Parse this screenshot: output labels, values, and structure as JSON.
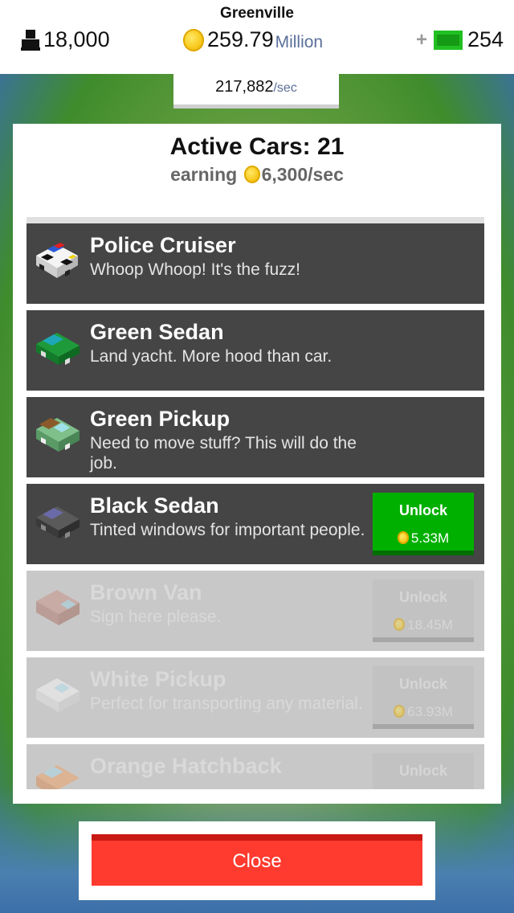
{
  "hud": {
    "city": "Greenville",
    "population": "18,000",
    "money_value": "259.79",
    "money_unit": "Million",
    "cash_plus": "+",
    "cash": "254",
    "rate_value": "217,882",
    "rate_unit": "/sec"
  },
  "panel": {
    "title": "Active Cars: 21",
    "earning_prefix": "earning",
    "earning_value": "6,300/sec"
  },
  "cars": [
    {
      "name": "Police Cruiser",
      "desc": "Whoop Whoop! It's the fuzz!",
      "locked": false
    },
    {
      "name": "Green Sedan",
      "desc": "Land yacht. More hood than car.",
      "locked": false
    },
    {
      "name": "Green Pickup",
      "desc": "Need to move stuff? This will do the job.",
      "locked": false
    },
    {
      "name": "Black Sedan",
      "desc": "Tinted windows for important people.",
      "locked": false,
      "unlock": "Unlock",
      "price": "5.33M"
    },
    {
      "name": "Brown Van",
      "desc": "Sign here please.",
      "locked": true,
      "unlock": "Unlock",
      "price": "18.45M"
    },
    {
      "name": "White Pickup",
      "desc": "Perfect for transporting any material.",
      "locked": true,
      "unlock": "Unlock",
      "price": "63.93M"
    },
    {
      "name": "Orange Hatchback",
      "desc": "",
      "locked": true,
      "unlock": "Unlock",
      "price": ""
    }
  ],
  "close_label": "Close",
  "colors": {
    "unlock_active": "#00b000",
    "close_button": "#ff3a2e",
    "row_dark": "#454545",
    "row_locked": "#c8c8c8"
  }
}
